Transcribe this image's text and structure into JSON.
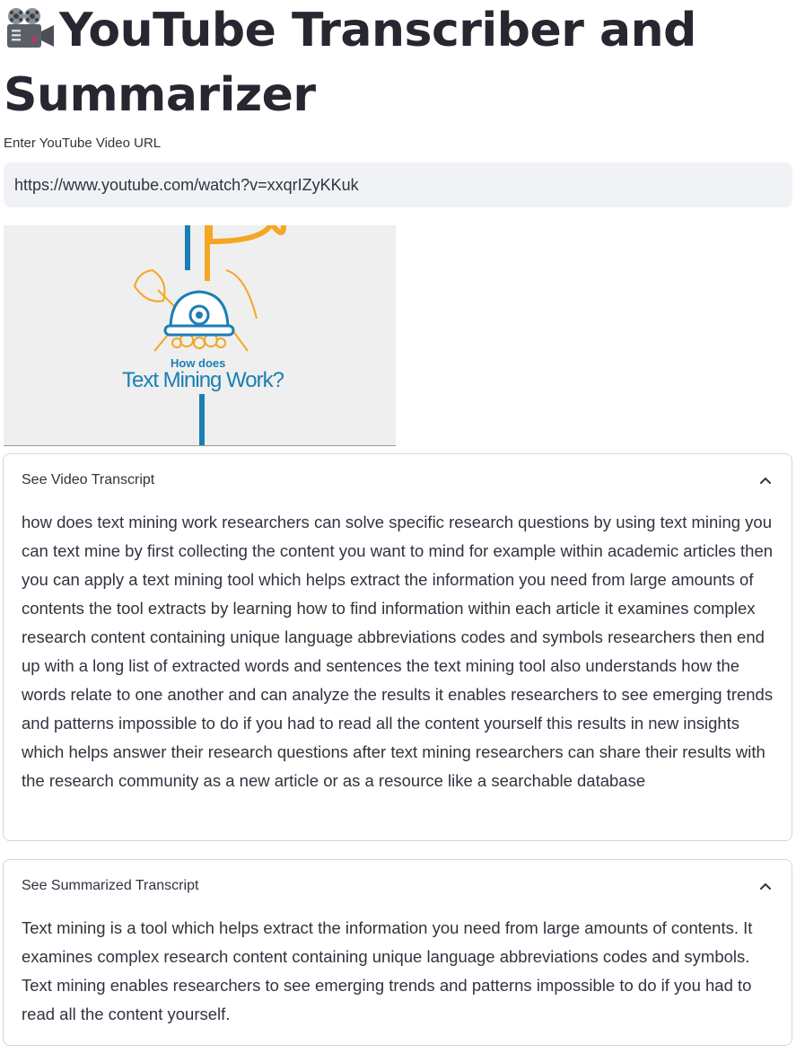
{
  "app": {
    "title_icon": "movie-camera-icon",
    "title": "YouTube Transcriber and Summarizer"
  },
  "url_field": {
    "label": "Enter YouTube Video URL",
    "value": "https://www.youtube.com/watch?v=xxqrIZyKKuk"
  },
  "video": {
    "thumbnail_caption_small": "How does",
    "thumbnail_caption_large": "Text Mining Work?"
  },
  "transcript_expander": {
    "label": "See Video Transcript",
    "expanded": true,
    "text": "how does text mining work researchers can solve specific research questions by using text mining you can text mine by first collecting the content you want to mind for example within academic articles then you can apply a text mining tool which helps extract the information you need from large amounts of contents the tool extracts by learning how to find information within each article it examines complex research content containing unique language abbreviations codes and symbols researchers then end up with a long list of extracted words and sentences the text mining tool also understands how the words relate to one another and can analyze the results it enables researchers to see emerging trends and patterns impossible to do if you had to read all the content yourself this results in new insights which helps answer their research questions after text mining researchers can share their results with the research community as a new article or as a resource like a searchable database"
  },
  "summary_expander": {
    "label": "See Summarized Transcript",
    "expanded": true,
    "text": "Text mining is a tool which helps extract the information you need from large amounts of contents. It examines complex research content containing unique language abbreviations codes and symbols. Text mining enables researchers to see emerging trends and patterns impossible to do if you had to read all the content yourself."
  },
  "colors": {
    "accent_blue": "#1a7fb5",
    "accent_orange": "#f5a623",
    "input_bg": "#f0f2f6",
    "border": "#d6d6d9",
    "text": "#31333f"
  }
}
